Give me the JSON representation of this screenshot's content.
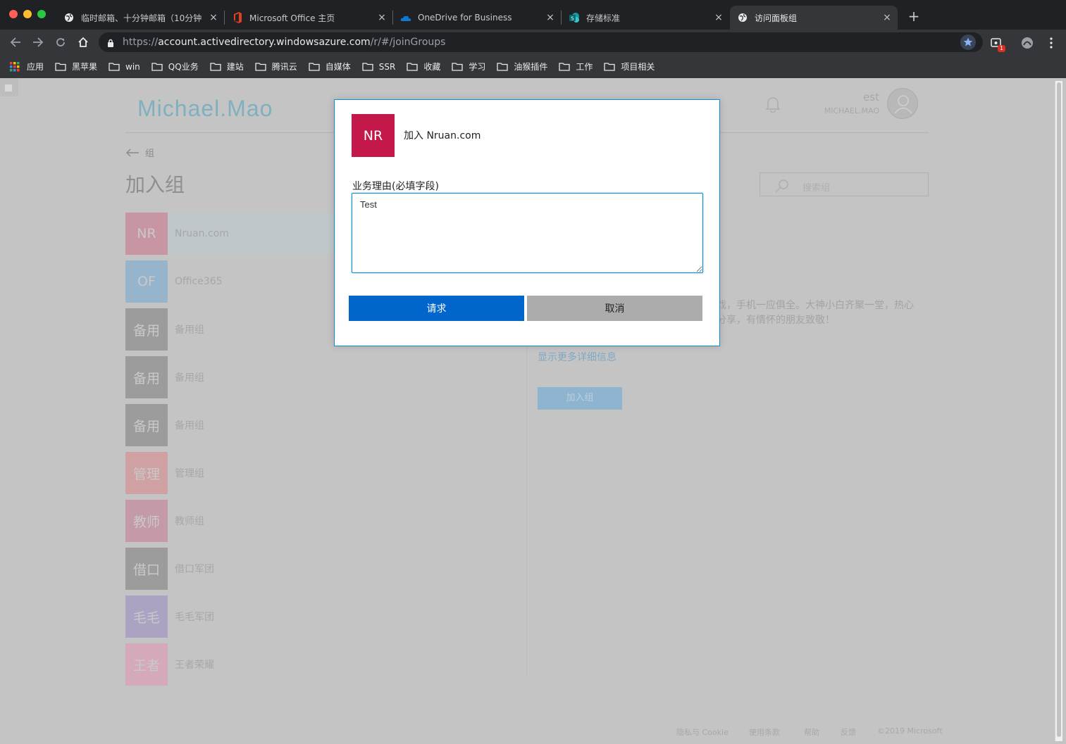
{
  "browser": {
    "tabs": [
      {
        "title": "临时邮箱、十分钟邮箱（10分钟",
        "icon": "globe-icon",
        "active": false
      },
      {
        "title": "Microsoft Office 主页",
        "icon": "office-icon",
        "active": false
      },
      {
        "title": "OneDrive for Business",
        "icon": "onedrive-icon",
        "active": false
      },
      {
        "title": "存储标准",
        "icon": "sharepoint-icon",
        "active": false
      },
      {
        "title": "访问面板组",
        "icon": "globe-icon",
        "active": true
      }
    ],
    "close_glyph": "×",
    "new_tab_glyph": "+",
    "url_scheme": "https://",
    "url_host": "account.activedirectory.windowsazure.com",
    "url_path": "/r/#/joinGroups",
    "extension_badge": "1",
    "bookmarks": [
      {
        "label": "应用",
        "icon": "apps-grid-icon"
      },
      {
        "label": "黑苹果",
        "icon": "folder-icon"
      },
      {
        "label": "win",
        "icon": "folder-icon"
      },
      {
        "label": "QQ业务",
        "icon": "folder-icon"
      },
      {
        "label": "建站",
        "icon": "folder-icon"
      },
      {
        "label": "腾讯云",
        "icon": "folder-icon"
      },
      {
        "label": "自媒体",
        "icon": "folder-icon"
      },
      {
        "label": "SSR",
        "icon": "folder-icon"
      },
      {
        "label": "收藏",
        "icon": "folder-icon"
      },
      {
        "label": "学习",
        "icon": "folder-icon"
      },
      {
        "label": "油猴插件",
        "icon": "folder-icon"
      },
      {
        "label": "工作",
        "icon": "folder-icon"
      },
      {
        "label": "项目相关",
        "icon": "folder-icon"
      }
    ]
  },
  "page": {
    "brand": "Michael.Mao",
    "user_name": "est",
    "user_org": "MICHAEL.MAO",
    "back_label": "组",
    "title": "加入组",
    "search_placeholder": "搜索组",
    "groups": [
      {
        "abbr": "NR",
        "name": "Nruan.com",
        "color": "#c896a3",
        "selected": true
      },
      {
        "abbr": "OF",
        "name": "Office365",
        "color": "#96b4cc",
        "selected": false
      },
      {
        "abbr": "备用",
        "name": "备用组",
        "color": "#9c9c9c",
        "selected": false
      },
      {
        "abbr": "备用",
        "name": "备用组",
        "color": "#9c9c9c",
        "selected": false
      },
      {
        "abbr": "备用",
        "name": "备用组",
        "color": "#9c9c9c",
        "selected": false
      },
      {
        "abbr": "管理",
        "name": "管理组",
        "color": "#d0a1a2",
        "selected": false
      },
      {
        "abbr": "教师",
        "name": "教师组",
        "color": "#c49aa8",
        "selected": false
      },
      {
        "abbr": "借口",
        "name": "借口军团",
        "color": "#9c9c9c",
        "selected": false
      },
      {
        "abbr": "毛毛",
        "name": "毛毛军团",
        "color": "#aca2c2",
        "selected": false
      },
      {
        "abbr": "王者",
        "name": "王者荣耀",
        "color": "#d4a9bc",
        "selected": false
      }
    ],
    "description_line1": "戏，手机一应俱全。大神小白齐聚一堂，热心",
    "description_line2": "分享，有情怀的朋友致敬！",
    "more_details_link": "显示更多详细信息",
    "join_button": "加入组",
    "footer": [
      "隐私与 Cookie",
      "使用条款",
      "帮助",
      "反馈",
      "©2019 Microsoft"
    ]
  },
  "modal": {
    "tile_abbr": "NR",
    "tile_color": "#c4184b",
    "title": "加入 Nruan.com",
    "reason_label": "业务理由(必填字段)",
    "reason_value": "Test",
    "request_button": "请求",
    "cancel_button": "取消"
  }
}
